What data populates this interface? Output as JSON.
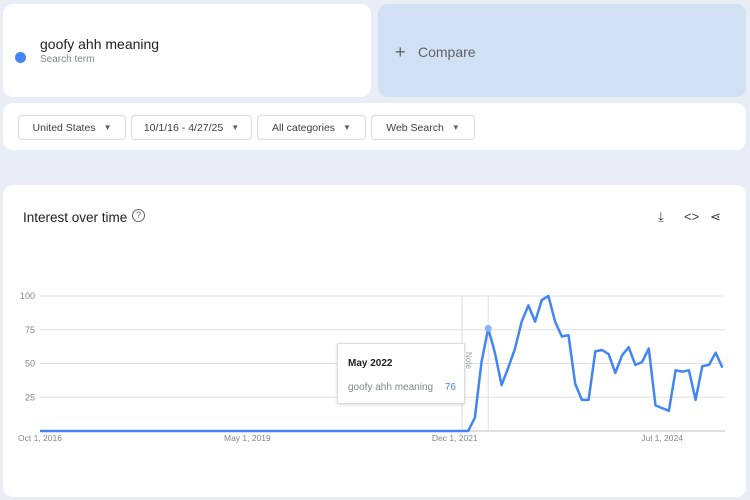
{
  "search": {
    "term": "goofy ahh meaning",
    "subtitle": "Search term",
    "color": "#4285f4"
  },
  "compare": {
    "label": "Compare",
    "icon": "plus-icon"
  },
  "filters": [
    {
      "label": "United States"
    },
    {
      "label": "10/1/16 - 4/27/25"
    },
    {
      "label": "All categories"
    },
    {
      "label": "Web Search"
    }
  ],
  "section": {
    "title": "Interest over time",
    "icons": [
      "help-icon",
      "download-icon",
      "embed-icon",
      "share-icon"
    ]
  },
  "tooltip": {
    "month": "May 2022",
    "term": "goofy ahh meaning",
    "value": "76"
  },
  "annotation": "Note",
  "chart_data": {
    "type": "line",
    "title": "",
    "xlabel": "",
    "ylabel": "",
    "ylim": [
      0,
      100
    ],
    "grid": true,
    "yticks": [
      25,
      50,
      75,
      100
    ],
    "xticks": [
      {
        "label": "Oct 1, 2016",
        "date": "2016-10"
      },
      {
        "label": "May 1, 2019",
        "date": "2019-05"
      },
      {
        "label": "Dec 1, 2021",
        "date": "2021-12"
      },
      {
        "label": "Jul 1, 2024",
        "date": "2024-07"
      }
    ],
    "series": [
      {
        "name": "goofy ahh meaning",
        "color": "#4285f4",
        "x": [
          "2016-10",
          "2022-01",
          "2022-02",
          "2022-03",
          "2022-04",
          "2022-05",
          "2022-06",
          "2022-07",
          "2022-08",
          "2022-09",
          "2022-10",
          "2022-11",
          "2022-12",
          "2023-01",
          "2023-02",
          "2023-03",
          "2023-04",
          "2023-05",
          "2023-06",
          "2023-07",
          "2023-08",
          "2023-09",
          "2023-10",
          "2023-11",
          "2023-12",
          "2024-01",
          "2024-02",
          "2024-03",
          "2024-04",
          "2024-05",
          "2024-06",
          "2024-07",
          "2024-08",
          "2024-09",
          "2024-10",
          "2024-11",
          "2024-12",
          "2025-01",
          "2025-02",
          "2025-03",
          "2025-04"
        ],
        "values": [
          0,
          0,
          0,
          10,
          51,
          76,
          58,
          34,
          47,
          61,
          81,
          93,
          81,
          97,
          100,
          81,
          70,
          71,
          35,
          23,
          23,
          59,
          60,
          57,
          43,
          56,
          62,
          49,
          51,
          61,
          19,
          17,
          15,
          45,
          44,
          45,
          23,
          48,
          49,
          58,
          47
        ]
      }
    ]
  }
}
